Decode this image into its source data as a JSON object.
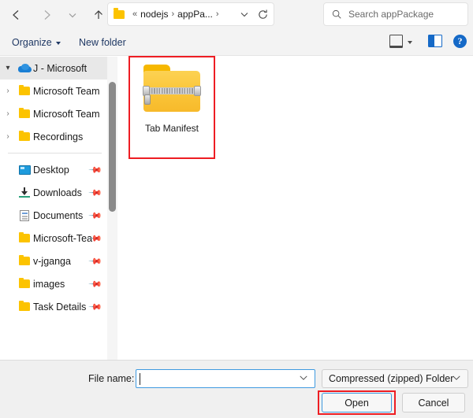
{
  "nav": {
    "back_icon": "arrow-left-icon",
    "forward_icon": "arrow-right-icon",
    "recent_icon": "chevron-down-icon",
    "up_icon": "arrow-up-icon",
    "breadcrumb": {
      "folder_icon": "folder-icon",
      "overflow": "«",
      "segments": [
        "nodejs",
        "appPa..."
      ],
      "separator": "›",
      "dropdown_icon": "chevron-down-icon",
      "refresh_icon": "refresh-icon"
    },
    "search": {
      "icon": "search-icon",
      "placeholder": "Search appPackage",
      "value": ""
    }
  },
  "toolbar": {
    "organize_label": "Organize",
    "new_folder_label": "New folder",
    "view_icon": "view-layout-icon",
    "view_caret_icon": "chevron-down-icon",
    "preview_pane_icon": "preview-pane-icon",
    "help_icon": "help-icon",
    "help_glyph": "?"
  },
  "sidebar": {
    "items": [
      {
        "label": "J - Microsoft",
        "icon": "onedrive-cloud-icon",
        "expander": "⌄",
        "expanded": true,
        "selected": true,
        "pinned": false
      },
      {
        "label": "Microsoft Team",
        "icon": "folder-icon",
        "expander": "›",
        "expanded": false,
        "selected": false,
        "pinned": false
      },
      {
        "label": "Microsoft Team",
        "icon": "folder-icon",
        "expander": "›",
        "expanded": false,
        "selected": false,
        "pinned": false
      },
      {
        "label": "Recordings",
        "icon": "folder-icon",
        "expander": "›",
        "expanded": false,
        "selected": false,
        "pinned": false
      },
      {
        "label": "Desktop",
        "icon": "desktop-icon",
        "expander": "",
        "expanded": false,
        "selected": false,
        "pinned": true
      },
      {
        "label": "Downloads",
        "icon": "downloads-icon",
        "expander": "",
        "expanded": false,
        "selected": false,
        "pinned": true
      },
      {
        "label": "Documents",
        "icon": "documents-icon",
        "expander": "",
        "expanded": false,
        "selected": false,
        "pinned": true
      },
      {
        "label": "Microsoft-Tea",
        "icon": "folder-icon",
        "expander": "",
        "expanded": false,
        "selected": false,
        "pinned": true
      },
      {
        "label": "v-jganga",
        "icon": "folder-icon",
        "expander": "",
        "expanded": false,
        "selected": false,
        "pinned": true
      },
      {
        "label": "images",
        "icon": "folder-icon",
        "expander": "",
        "expanded": false,
        "selected": false,
        "pinned": true
      },
      {
        "label": "Task Details",
        "icon": "folder-icon",
        "expander": "",
        "expanded": false,
        "selected": false,
        "pinned": true
      }
    ],
    "pin_glyph": "⍈"
  },
  "files": [
    {
      "name": "Tab Manifest",
      "icon": "zipped-folder-icon",
      "selected": true
    }
  ],
  "footer": {
    "file_name_label": "File name:",
    "file_name_value": "",
    "file_name_chevron": "⌄",
    "file_type_value": "Compressed (zipped) Folder",
    "file_type_chevron": "⌄",
    "open_label": "Open",
    "cancel_label": "Cancel"
  },
  "colors": {
    "annotation_red": "#ee1d23",
    "focus_blue": "#3f9ae0",
    "folder_yellow": "#fcc300",
    "command_text": "#1f3864"
  }
}
